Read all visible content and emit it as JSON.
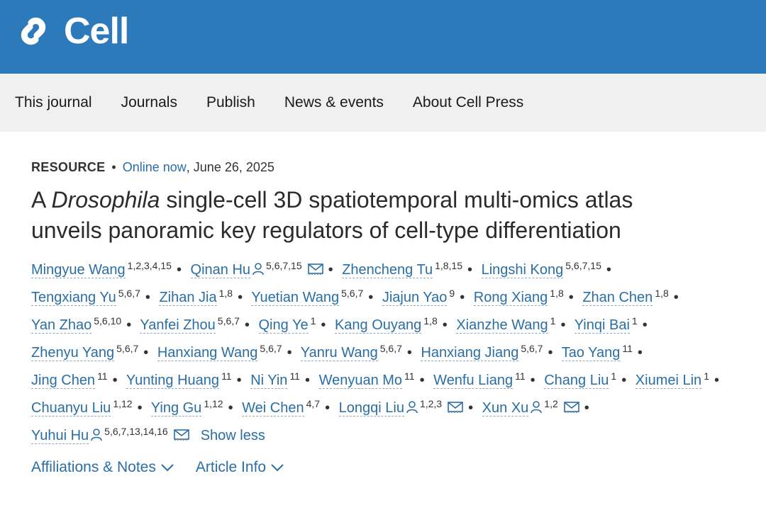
{
  "header": {
    "logo_text": "Cell",
    "logo_icon": "cell-press-logo-icon",
    "background": "#2d7abb"
  },
  "nav": {
    "items": [
      "This journal",
      "Journals",
      "Publish",
      "News & events",
      "About Cell Press"
    ]
  },
  "article": {
    "type": "RESOURCE",
    "online_status": "Online now",
    "date": ", June 26, 2025",
    "title_prefix": "A ",
    "title_italic": "Drosophila",
    "title_rest": " single-cell 3D spatiotemporal multi-omics atlas unveils panoramic key regulators of cell-type differentiation",
    "authors": [
      {
        "name": "Mingyue Wang",
        "aff": "1,2,3,4,15"
      },
      {
        "name": "Qinan Hu",
        "aff": "5,6,7,15"
      },
      {
        "name": "Zhencheng Tu",
        "aff": "1,8,15"
      },
      {
        "name": "Lingshi Kong",
        "aff": "5,6,7,15"
      },
      {
        "name": "Tengxiang Yu",
        "aff": "5,6,7"
      },
      {
        "name": "Zihan Jia",
        "aff": "1,8"
      },
      {
        "name": "Yuetian Wang",
        "aff": "5,6,7"
      },
      {
        "name": "Jiajun Yao",
        "aff": "9"
      },
      {
        "name": "Rong Xiang",
        "aff": "1,8"
      },
      {
        "name": "Zhan Chen",
        "aff": "1,8"
      },
      {
        "name": "Yan Zhao",
        "aff": "5,6,10"
      },
      {
        "name": "Yanfei Zhou",
        "aff": "5,6,7"
      },
      {
        "name": "Qing Ye",
        "aff": "1"
      },
      {
        "name": "Kang Ouyang",
        "aff": "1,8"
      },
      {
        "name": "Xianzhe Wang",
        "aff": "1"
      },
      {
        "name": "Yinqi Bai",
        "aff": "1"
      },
      {
        "name": "Zhenyu Yang",
        "aff": "5,6,7"
      },
      {
        "name": "Hanxiang Wang",
        "aff": "5,6,7"
      },
      {
        "name": "Yanru Wang",
        "aff": "5,6,7"
      },
      {
        "name": "Hanxiang Jiang",
        "aff": "5,6,7"
      },
      {
        "name": "Tao Yang",
        "aff": "11"
      },
      {
        "name": "Jing Chen",
        "aff": "11"
      },
      {
        "name": "Yunting Huang",
        "aff": "11"
      },
      {
        "name": "Ni Yin",
        "aff": "11"
      },
      {
        "name": "Wenyuan Mo",
        "aff": "11"
      },
      {
        "name": "Wenfu Liang",
        "aff": "11"
      },
      {
        "name": "Chang Liu",
        "aff": "1"
      },
      {
        "name": "Xiumei Lin",
        "aff": "1"
      },
      {
        "name": "Chuanyu Liu",
        "aff": "1,12"
      },
      {
        "name": "Ying Gu",
        "aff": "1,12"
      },
      {
        "name": "Wei Chen",
        "aff": "4,7"
      },
      {
        "name": "Longqi Liu",
        "aff": "1,2,3"
      },
      {
        "name": "Xun Xu",
        "aff": "1,2"
      },
      {
        "name": "Yuhui Hu",
        "aff": "5,6,7,13,14,16"
      }
    ],
    "show_less": "Show less",
    "links": [
      "Affiliations & Notes",
      "Article Info"
    ]
  }
}
